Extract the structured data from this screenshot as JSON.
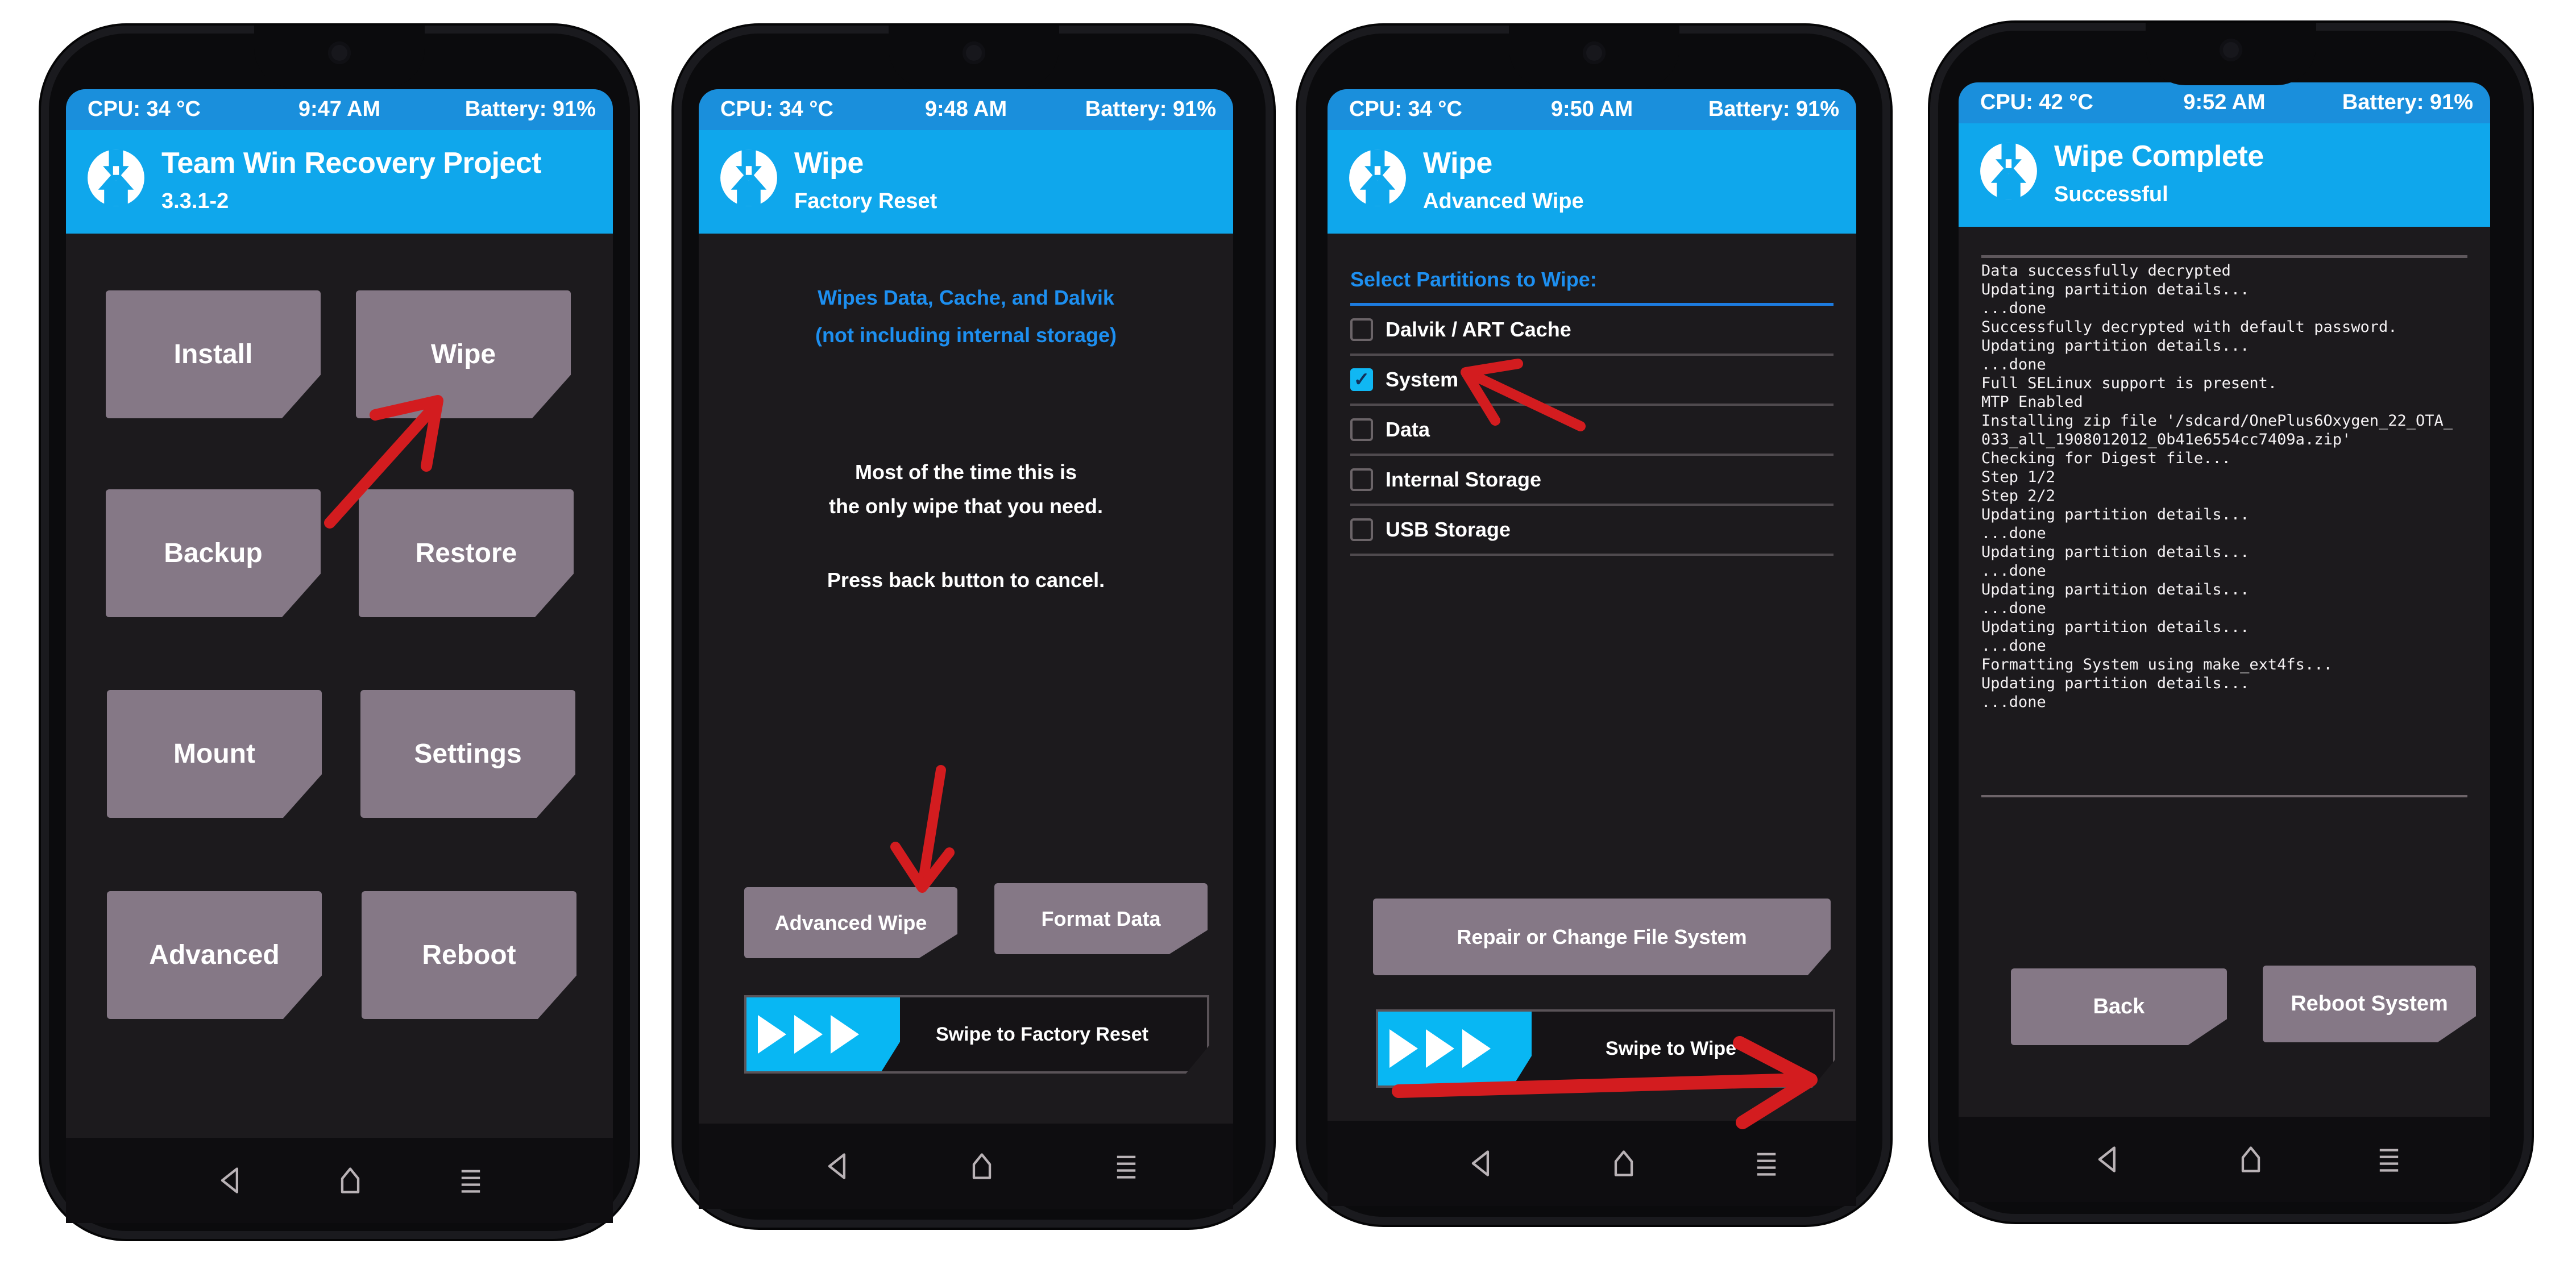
{
  "annotation_color": "#d31c1f",
  "accent_color": "#0fa7ec",
  "statusbar_color": "#1a8fdc",
  "button_color": "#857886",
  "phones": [
    {
      "status": {
        "cpu": "CPU: 34 °C",
        "time": "9:47 AM",
        "battery": "Battery: 91%"
      },
      "header": {
        "logo_icon": "twrp-logo-icon",
        "title": "Team Win Recovery Project",
        "subtitle": "3.3.1-2"
      },
      "buttons": [
        "Install",
        "Wipe",
        "Backup",
        "Restore",
        "Mount",
        "Settings",
        "Advanced",
        "Reboot"
      ],
      "annotation": "arrow pointing to Wipe"
    },
    {
      "status": {
        "cpu": "CPU: 34 °C",
        "time": "9:48 AM",
        "battery": "Battery: 91%"
      },
      "header": {
        "logo_icon": "twrp-logo-icon",
        "title": "Wipe",
        "subtitle": "Factory Reset"
      },
      "info_blue": [
        "Wipes Data, Cache, and Dalvik",
        "(not including internal storage)"
      ],
      "info_white": [
        "Most of the time this is",
        "the only wipe that you need.",
        "Press back button to cancel."
      ],
      "buttons": [
        "Advanced Wipe",
        "Format Data"
      ],
      "swipe_label": "Swipe to Factory Reset",
      "annotation": "arrow pointing to Advanced Wipe"
    },
    {
      "status": {
        "cpu": "CPU: 34 °C",
        "time": "9:50 AM",
        "battery": "Battery: 91%"
      },
      "header": {
        "logo_icon": "twrp-logo-icon",
        "title": "Wipe",
        "subtitle": "Advanced Wipe"
      },
      "partitions_heading": "Select Partitions to Wipe:",
      "partitions": [
        {
          "label": "Dalvik / ART Cache",
          "checked": false
        },
        {
          "label": "System",
          "checked": true
        },
        {
          "label": "Data",
          "checked": false
        },
        {
          "label": "Internal Storage",
          "checked": false
        },
        {
          "label": "USB Storage",
          "checked": false
        }
      ],
      "check_glyph": "✓",
      "buttons": [
        "Repair or Change File System"
      ],
      "swipe_label": "Swipe to Wipe",
      "annotation": "arrows pointing to System and swipe direction"
    },
    {
      "status": {
        "cpu": "CPU: 42 °C",
        "time": "9:52 AM",
        "battery": "Battery: 91%"
      },
      "header": {
        "logo_icon": "twrp-logo-icon",
        "title": "Wipe Complete",
        "subtitle": "Successful"
      },
      "console": [
        "Data successfully decrypted",
        "Updating partition details...",
        "...done",
        "Successfully decrypted with default password.",
        "Updating partition details...",
        "...done",
        "Full SELinux support is present.",
        "MTP Enabled",
        "Installing zip file '/sdcard/OnePlus6Oxygen_22_OTA_",
        "033_all_1908012012_0b41e6554cc7409a.zip'",
        "Checking for Digest file...",
        "Step 1/2",
        "Step 2/2",
        "Updating partition details...",
        "...done",
        "Updating partition details...",
        "...done",
        "Updating partition details...",
        "...done",
        "Updating partition details...",
        "...done",
        "Formatting System using make_ext4fs...",
        "Updating partition details...",
        "...done"
      ],
      "buttons": [
        "Back",
        "Reboot System"
      ]
    }
  ],
  "navbar": {
    "back_icon": "back-triangle-icon",
    "home_icon": "home-icon",
    "menu_icon": "menu-lines-icon"
  }
}
